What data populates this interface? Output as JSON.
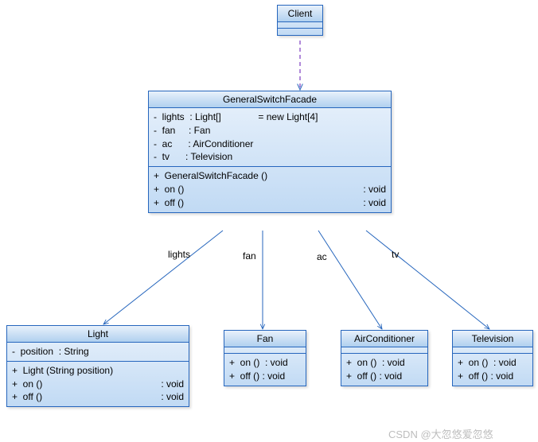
{
  "classes": {
    "client": {
      "name": "Client"
    },
    "facade": {
      "name": "GeneralSwitchFacade",
      "attributes": [
        {
          "line": "-  lights  : Light[]              = new Light[4]"
        },
        {
          "line": "-  fan     : Fan"
        },
        {
          "line": "-  ac      : AirConditioner"
        },
        {
          "line": "-  tv      : Television"
        }
      ],
      "operations": [
        {
          "name": "+  GeneralSwitchFacade ()",
          "ret": ""
        },
        {
          "name": "+  on ()",
          "ret": ": void"
        },
        {
          "name": "+  off ()",
          "ret": ": void"
        }
      ]
    },
    "light": {
      "name": "Light",
      "attributes": [
        {
          "line": "-  position  : String"
        }
      ],
      "operations": [
        {
          "name": "+  Light (String position)",
          "ret": ""
        },
        {
          "name": "+  on ()",
          "ret": ": void"
        },
        {
          "name": "+  off ()",
          "ret": ": void"
        }
      ]
    },
    "fan": {
      "name": "Fan",
      "operations": [
        {
          "name": "+  on ()  : void"
        },
        {
          "name": "+  off () : void"
        }
      ]
    },
    "ac": {
      "name": "AirConditioner",
      "operations": [
        {
          "name": "+  on ()  : void"
        },
        {
          "name": "+  off () : void"
        }
      ]
    },
    "tv": {
      "name": "Television",
      "operations": [
        {
          "name": "+  on ()  : void"
        },
        {
          "name": "+  off () : void"
        }
      ]
    }
  },
  "edges": {
    "lights": "lights",
    "fan": "fan",
    "ac": "ac",
    "tv": "tv"
  },
  "watermark": "CSDN @大忽悠爱忽悠"
}
